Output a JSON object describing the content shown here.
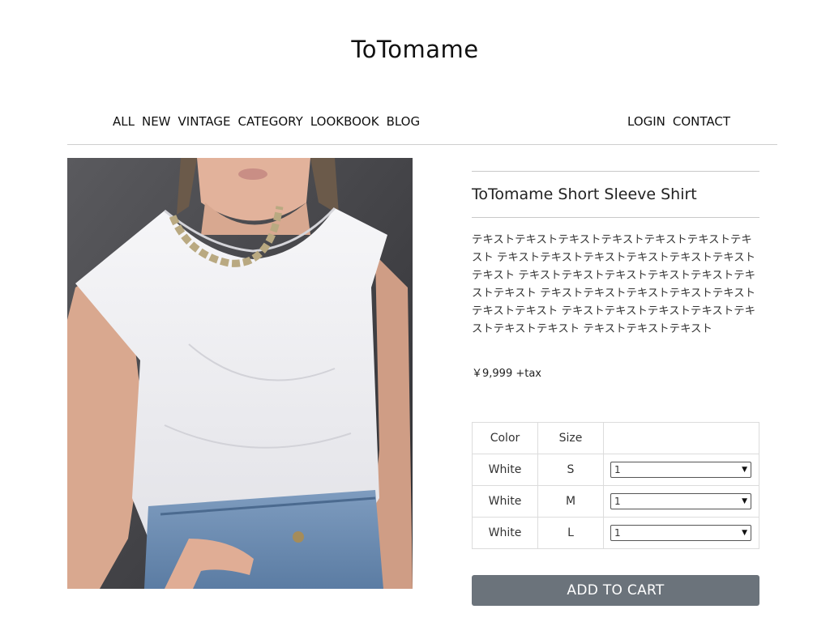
{
  "brand": {
    "name": "ToTomame"
  },
  "nav": {
    "left": [
      "ALL",
      "NEW",
      "VINTAGE",
      "CATEGORY",
      "LOOKBOOK",
      "BLOG"
    ],
    "right": [
      "LOGIN",
      "CONTACT"
    ]
  },
  "product": {
    "title": "ToTomame Short Sleeve Shirt",
    "description": "テキストテキストテキストテキストテキストテキストテキスト テキストテキストテキストテキストテキストテキストテキスト テキストテキストテキストテキストテキストテキストテキスト テキストテキストテキストテキストテキストテキストテキスト テキストテキストテキストテキストテキストテキストテキスト テキストテキストテキスト",
    "price": "￥9,999 +tax",
    "image": "model-white-sleeveless-shirt"
  },
  "variants": {
    "headers": {
      "color": "Color",
      "size": "Size",
      "qty": ""
    },
    "rows": [
      {
        "color": "White",
        "size": "S",
        "qty": "1"
      },
      {
        "color": "White",
        "size": "M",
        "qty": "1"
      },
      {
        "color": "White",
        "size": "L",
        "qty": "1"
      }
    ]
  },
  "cta": {
    "add_to_cart": "ADD TO CART"
  },
  "colors": {
    "button_bg": "#6b737b",
    "rule": "#cfcfcf"
  }
}
